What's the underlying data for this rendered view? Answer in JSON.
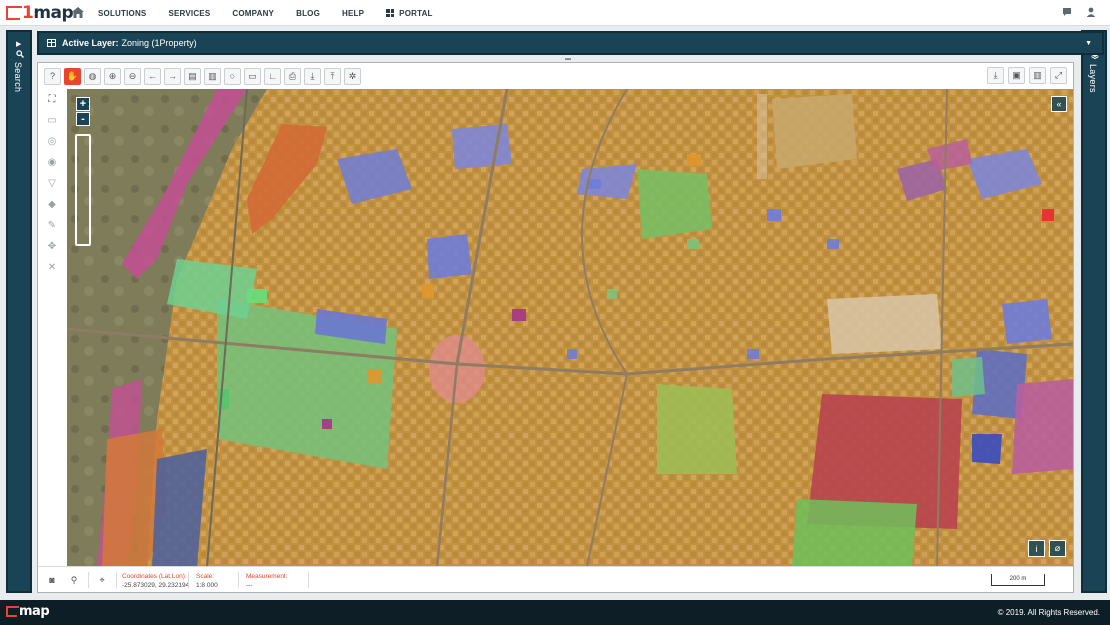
{
  "brand": {
    "name": "map",
    "one": "1"
  },
  "nav": {
    "items": [
      "SOLUTIONS",
      "SERVICES",
      "COMPANY",
      "BLOG",
      "HELP"
    ],
    "portal": "PORTAL"
  },
  "left_panel": {
    "label": "Search"
  },
  "right_panel": {
    "label": "Layers"
  },
  "active_layer": {
    "label": "Active Layer:",
    "value": "Zoning (1Property)"
  },
  "status": {
    "coords_label": "Coordinates (Lat,Lon):",
    "coords_value": "-25.873029, 29.232194",
    "scale_label": "Scale:",
    "scale_value": "1:8 000",
    "measurement_label": "Measurement:",
    "measurement_value": "---",
    "scalebar": "200 m"
  },
  "footer": {
    "copyright": "© 2019. All Rights Reserved."
  },
  "colors": {
    "brand_red": "#e8442e",
    "panel_dark": "#1a4455",
    "zone_residential": "#c99a45",
    "zone_business": "#7e86d6",
    "zone_industrial": "#b85f9c",
    "zone_open": "#6fbf5a",
    "zone_institutional": "#b8444f"
  }
}
